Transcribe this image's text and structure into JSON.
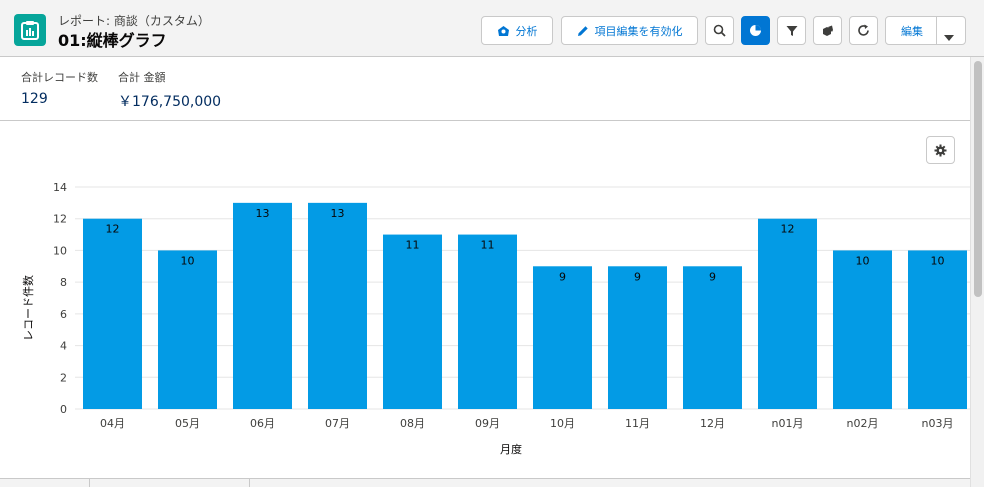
{
  "header": {
    "subtitle": "レポート: 商談（カスタム）",
    "title": "01:縦棒グラフ",
    "buttons": {
      "analyze": "分析",
      "enable_field_edit": "項目編集を有効化",
      "edit": "編集"
    }
  },
  "metrics": [
    {
      "label": "合計レコード数",
      "value": "129"
    },
    {
      "label": "合計 金額",
      "value": "￥176,750,000"
    }
  ],
  "colors": {
    "accent": "#0176d3",
    "bar": "#039be5",
    "app_icon": "#06a59a"
  },
  "chart_data": {
    "type": "bar",
    "categories": [
      "04月",
      "05月",
      "06月",
      "07月",
      "08月",
      "09月",
      "10月",
      "11月",
      "12月",
      "n01月",
      "n02月",
      "n03月"
    ],
    "values": [
      12,
      10,
      13,
      13,
      11,
      11,
      9,
      9,
      9,
      12,
      10,
      10
    ],
    "xlabel": "月度",
    "ylabel": "レコード件数",
    "ylim": [
      0,
      14
    ],
    "yticks": [
      0,
      2,
      4,
      6,
      8,
      10,
      12,
      14
    ],
    "grid": true,
    "data_labels": true
  }
}
